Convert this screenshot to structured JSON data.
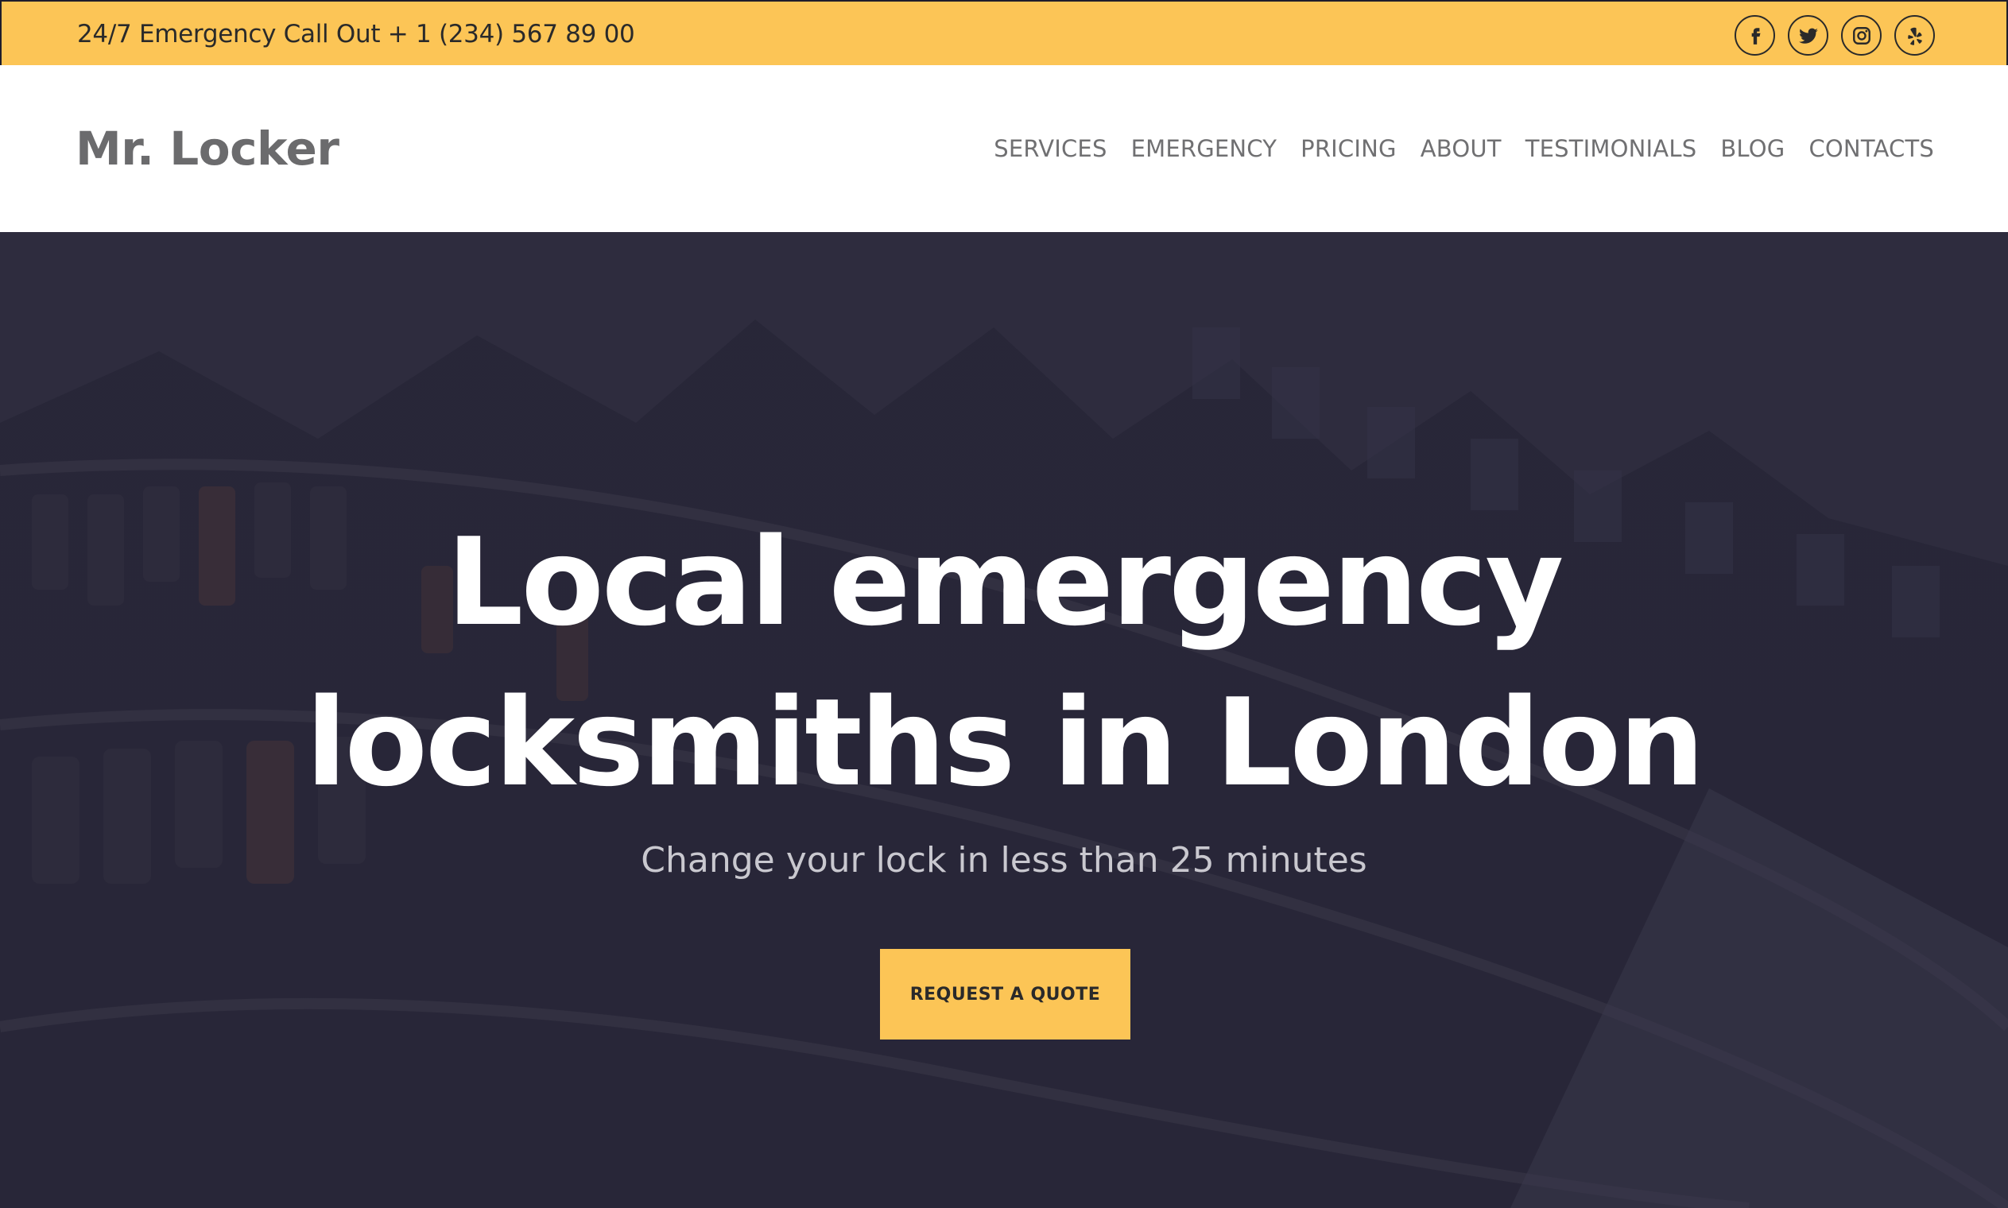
{
  "topbar": {
    "phone_text": "24/7 Emergency Call Out + 1 (234) 567 89 00",
    "social": [
      "facebook-icon",
      "twitter-icon",
      "instagram-icon",
      "yelp-icon"
    ]
  },
  "header": {
    "logo": "Mr. Locker",
    "nav": [
      "SERVICES",
      "EMERGENCY",
      "PRICING",
      "ABOUT",
      "TESTIMONIALS",
      "BLOG",
      "CONTACTS"
    ]
  },
  "hero": {
    "title_line1": "Local emergency",
    "title_line2": "locksmiths in London",
    "subtitle": "Change your lock in less than 25 minutes",
    "cta_label": "REQUEST A QUOTE"
  },
  "colors": {
    "accent": "#fcc556",
    "hero_overlay": "#2c2b3a",
    "nav_text": "#707072",
    "logo_text": "#6b6b6d"
  }
}
